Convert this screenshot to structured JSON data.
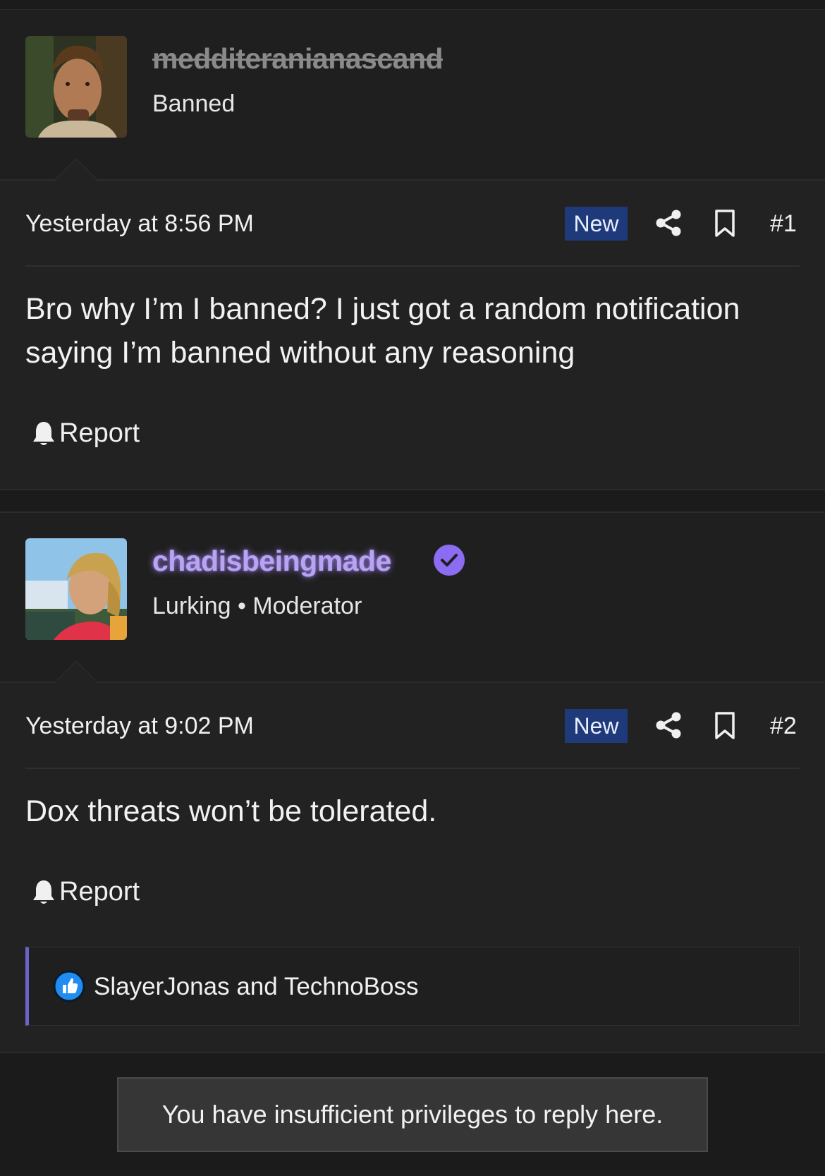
{
  "posts": [
    {
      "username": "medditeranianascand",
      "user_title": "Banned",
      "date": "Yesterday at 8:56 PM",
      "badge": "New",
      "post_number": "#1",
      "body": "Bro why I’m I banned? I just got a random notification saying I’m banned without any reasoning",
      "report_label": "Report"
    },
    {
      "username": "chadisbeingmade",
      "user_title": "Lurking • Moderator",
      "date": "Yesterday at 9:02 PM",
      "badge": "New",
      "post_number": "#2",
      "body": "Dox threats won’t be tolerated.",
      "report_label": "Report",
      "reactions": "SlayerJonas and TechnoBoss"
    }
  ],
  "notice": "You have insufficient privileges to reply here.",
  "colors": {
    "background": "#222222",
    "moderator_name": "#b9a4f4",
    "verified_badge": "#8b6cf2",
    "new_badge": "#1f3a7a",
    "reaction_accent": "#6a63c9",
    "like_blue": "#1e8cf0"
  },
  "icons": [
    "share-icon",
    "bookmark-icon",
    "bell-icon",
    "verified-check-icon",
    "like-icon"
  ]
}
